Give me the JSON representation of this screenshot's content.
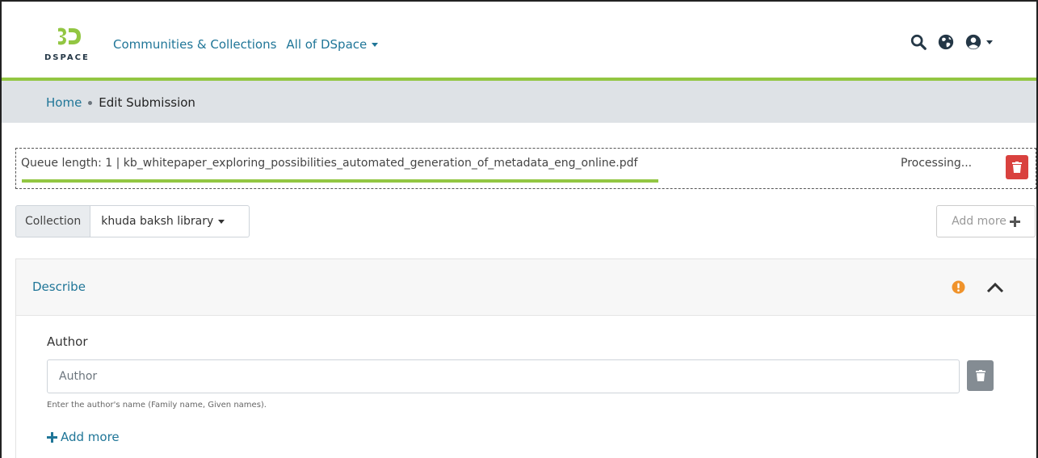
{
  "header": {
    "logo_text": "DSPACE",
    "nav": {
      "communities": "Communities & Collections",
      "all_of_dspace": "All of DSpace"
    },
    "icons": [
      "search-icon",
      "globe-icon",
      "user-icon",
      "chevron-down-icon"
    ]
  },
  "breadcrumb": {
    "home": "Home",
    "current": "Edit Submission"
  },
  "upload_queue": {
    "text": "Queue length: 1 | kb_whitepaper_exploring_possibilities_automated_generation_of_metadata_eng_online.pdf",
    "status": "Processing...",
    "progress": 0.63,
    "colors": {
      "progress": "#92c642",
      "delete": "#d9413e"
    }
  },
  "collection": {
    "label": "Collection",
    "selected": "khuda baksh library",
    "add_more": "Add more"
  },
  "describe": {
    "title": "Describe",
    "author": {
      "label": "Author",
      "placeholder": "Author",
      "value": "",
      "help": "Enter the author's name (Family name, Given names).",
      "add_more": "Add more"
    },
    "colors": {
      "warning": "#f0932b",
      "link": "#207698"
    }
  },
  "theme": {
    "accent": "#92c642",
    "link": "#207698",
    "breadcrumb_bg": "#dee2e6"
  }
}
